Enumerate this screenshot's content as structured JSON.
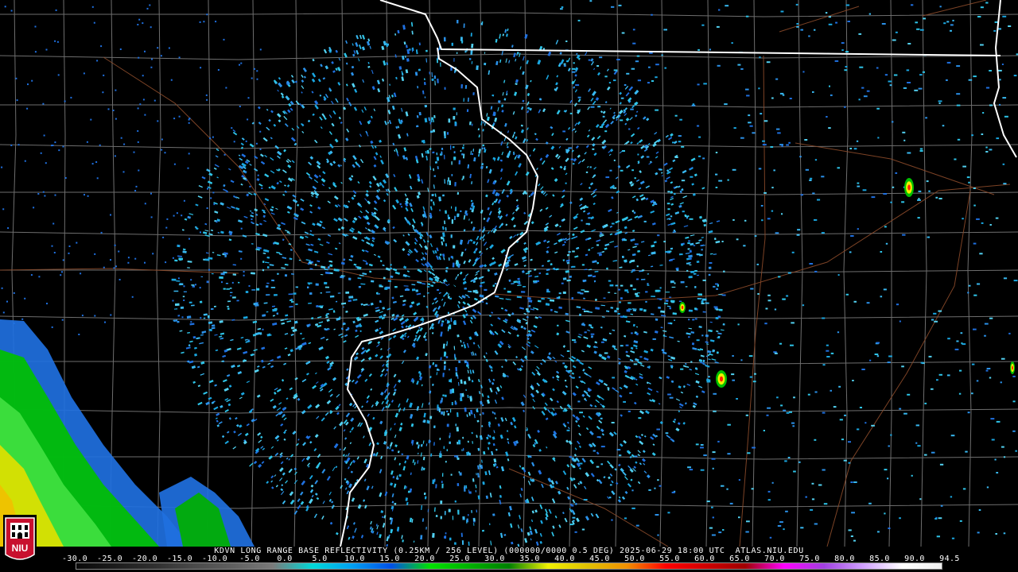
{
  "product": {
    "status_line": "KDVN LONG RANGE BASE REFLECTIVITY (0.25KM / 256 LEVEL) (000000/0000 0.5 DEG) 2025-06-29 18:00 UTC  ATLAS.NIU.EDU"
  },
  "legend": {
    "scale_labels": [
      "-30.0",
      "-25.0",
      "-20.0",
      "-15.0",
      "-10.0",
      "-5.0",
      "0.0",
      "5.0",
      "10.0",
      "15.0",
      "20.0",
      "25.0",
      "30.0",
      "35.0",
      "40.0",
      "45.0",
      "50.0",
      "55.0",
      "60.0",
      "65.0",
      "70.0",
      "75.0",
      "80.0",
      "85.0",
      "90.0",
      "94.5"
    ],
    "colors": [
      "#0a0a0a",
      "#1c1c1c",
      "#303030",
      "#4a4a4a",
      "#606060",
      "#7a7a7a",
      "#00d8d8",
      "#00a0f0",
      "#0050e8",
      "#00e000",
      "#00b000",
      "#008000",
      "#f0f000",
      "#e0c000",
      "#f09000",
      "#ff0000",
      "#d00000",
      "#a00000",
      "#ff00ff",
      "#a040e0",
      "#d0a0ff",
      "#ffffff",
      "#f0f0f0"
    ]
  },
  "logo": {
    "text": "NIU",
    "fill": "#c8102e"
  },
  "map": {
    "background": "#000000",
    "county_line_color": "#6e6e6e",
    "state_line_color": "#ffffff",
    "road_color": "#8a4a2a",
    "echo_color": "#2ec4e8",
    "radar_site_color": "#000000"
  }
}
